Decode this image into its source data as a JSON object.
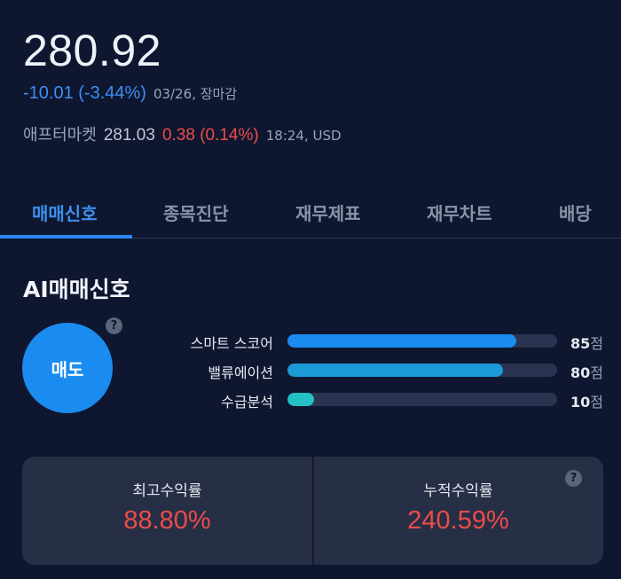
{
  "quote": {
    "price": "280.92",
    "change": "-10.01 (-3.44%)",
    "date": "03/26, 장마감",
    "after_market_label": "애프터마켓",
    "after_market_price": "281.03",
    "after_market_change": "0.38 (0.14%)",
    "after_market_time": "18:24, USD"
  },
  "tabs": [
    {
      "label": "매매신호",
      "active": true
    },
    {
      "label": "종목진단",
      "active": false
    },
    {
      "label": "재무제표",
      "active": false
    },
    {
      "label": "재무차트",
      "active": false
    },
    {
      "label": "배당",
      "active": false
    }
  ],
  "ai_signal": {
    "title": "AI매매신호",
    "signal": "매도",
    "help_icon": "question-icon",
    "scores": [
      {
        "label": "스마트 스코어",
        "value": "85",
        "unit": "점",
        "percent": 85,
        "color": "#1a8cf0"
      },
      {
        "label": "밸류에이션",
        "value": "80",
        "unit": "점",
        "percent": 80,
        "color": "#1c9ad6"
      },
      {
        "label": "수급분석",
        "value": "10",
        "unit": "점",
        "percent": 10,
        "color": "#22c1c3"
      }
    ]
  },
  "stats": {
    "max_return_label": "최고수익률",
    "max_return_value": "88.80%",
    "cum_return_label": "누적수익률",
    "cum_return_value": "240.59%"
  },
  "colors": {
    "background": "#0f1730",
    "accent": "#2a86f0",
    "negative_blue": "#3d8ef5",
    "positive_red": "#ee4b4b"
  }
}
